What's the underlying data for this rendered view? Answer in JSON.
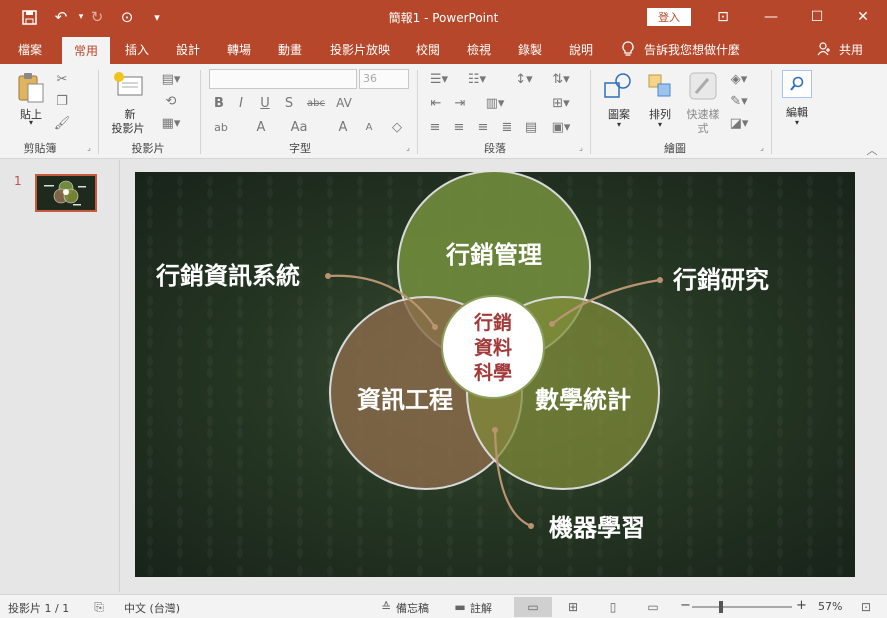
{
  "titlebar": {
    "doc_title": "簡報1 - PowerPoint",
    "login_label": "登入",
    "save_icon": "💾",
    "undo_icon": "↶",
    "redo_icon": "↻",
    "present_icon": "⊙",
    "customize_icon": "▾",
    "ribbon_options_icon": "⊡",
    "minimize_icon": "—",
    "maximize_icon": "☐",
    "close_icon": "✕"
  },
  "tabs": [
    "檔案",
    "常用",
    "插入",
    "設計",
    "轉場",
    "動畫",
    "投影片放映",
    "校閱",
    "檢視",
    "錄製",
    "說明"
  ],
  "tell_me": {
    "icon": "💡",
    "text": "告訴我您想做什麼"
  },
  "share": {
    "icon": "⚇",
    "label": "共用"
  },
  "ribbon": {
    "clipboard": {
      "label": "剪貼簿",
      "paste_label": "貼上"
    },
    "slides": {
      "label": "投影片",
      "new_slide_line1": "新",
      "new_slide_line2": "投影片"
    },
    "font": {
      "label": "字型",
      "font_name": "",
      "font_size": "36",
      "row2": [
        "B",
        "I",
        "U",
        "S",
        "abc",
        "AV"
      ],
      "row3": [
        "ab",
        "A",
        "Aa",
        "A",
        "A",
        "◇"
      ]
    },
    "paragraph": {
      "label": "段落"
    },
    "drawing": {
      "label": "繪圖",
      "shapes": "圖案",
      "arrange": "排列",
      "quick_styles_1": "快速樣",
      "quick_styles_2": "式"
    },
    "editing": {
      "label": "編輯"
    }
  },
  "thumbnail": {
    "number": "1"
  },
  "slide": {
    "circles": {
      "top": "行銷管理",
      "left": "資訊工程",
      "right": "數學統計",
      "center_line1": "行銷",
      "center_line2": "資料",
      "center_line3": "科學"
    },
    "callouts": {
      "top_left": "行銷資訊系統",
      "top_right": "行銷研究",
      "bottom": "機器學習"
    },
    "colors": {
      "top_circle": "#6f8a3c",
      "left_circle": "#8a6a4a",
      "right_circle": "#7f8a38",
      "center_text": "#a33a3a",
      "connector": "#b99471"
    }
  },
  "statusbar": {
    "slide_info": "投影片 1 / 1",
    "language": "中文 (台灣)",
    "notes": "備忘稿",
    "comments": "註解",
    "zoom_minus": "−",
    "zoom_plus": "+",
    "zoom": "57%",
    "zoom_level": 0.57
  }
}
